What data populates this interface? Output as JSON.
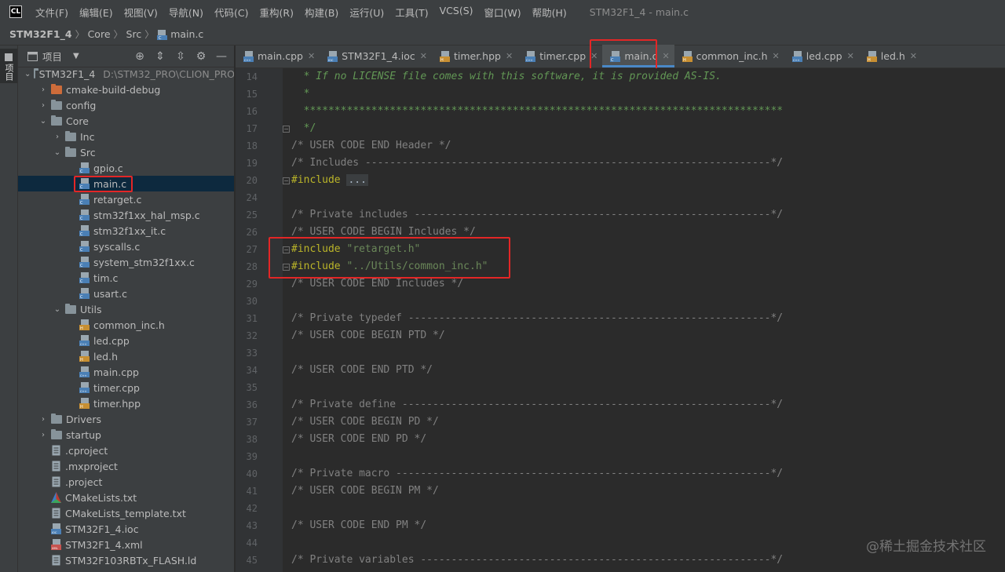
{
  "app": {
    "logo_text": "CL",
    "window_title": "STM32F1_4 - main.c"
  },
  "menu": [
    "文件(F)",
    "编辑(E)",
    "视图(V)",
    "导航(N)",
    "代码(C)",
    "重构(R)",
    "构建(B)",
    "运行(U)",
    "工具(T)",
    "VCS(S)",
    "窗口(W)",
    "帮助(H)"
  ],
  "breadcrumb": {
    "project": "STM32F1_4",
    "items": [
      "Core",
      "Src",
      "main.c"
    ]
  },
  "toolstrip": {
    "project_tab_label": "项目"
  },
  "project_panel": {
    "title": "项目",
    "tree": [
      {
        "label": "STM32F1_4",
        "hint": "D:\\STM32_PRO\\CLION_PRO",
        "kind": "folder",
        "depth": 0,
        "arrow": "down"
      },
      {
        "label": "cmake-build-debug",
        "kind": "folder-excluded",
        "depth": 1,
        "arrow": "right"
      },
      {
        "label": "config",
        "kind": "folder",
        "depth": 1,
        "arrow": "right"
      },
      {
        "label": "Core",
        "kind": "folder",
        "depth": 1,
        "arrow": "down"
      },
      {
        "label": "Inc",
        "kind": "folder",
        "depth": 2,
        "arrow": "right"
      },
      {
        "label": "Src",
        "kind": "folder",
        "depth": 2,
        "arrow": "down"
      },
      {
        "label": "gpio.c",
        "kind": "c",
        "depth": 3
      },
      {
        "label": "main.c",
        "kind": "c",
        "depth": 3,
        "selected": true
      },
      {
        "label": "retarget.c",
        "kind": "c",
        "depth": 3
      },
      {
        "label": "stm32f1xx_hal_msp.c",
        "kind": "c",
        "depth": 3
      },
      {
        "label": "stm32f1xx_it.c",
        "kind": "c",
        "depth": 3
      },
      {
        "label": "syscalls.c",
        "kind": "c",
        "depth": 3
      },
      {
        "label": "system_stm32f1xx.c",
        "kind": "c",
        "depth": 3
      },
      {
        "label": "tim.c",
        "kind": "c",
        "depth": 3
      },
      {
        "label": "usart.c",
        "kind": "c",
        "depth": 3
      },
      {
        "label": "Utils",
        "kind": "folder",
        "depth": 2,
        "arrow": "down"
      },
      {
        "label": "common_inc.h",
        "kind": "h",
        "depth": 3
      },
      {
        "label": "led.cpp",
        "kind": "cpp",
        "depth": 3
      },
      {
        "label": "led.h",
        "kind": "h",
        "depth": 3
      },
      {
        "label": "main.cpp",
        "kind": "cpp",
        "depth": 3
      },
      {
        "label": "timer.cpp",
        "kind": "cpp",
        "depth": 3
      },
      {
        "label": "timer.hpp",
        "kind": "h",
        "depth": 3
      },
      {
        "label": "Drivers",
        "kind": "folder",
        "depth": 1,
        "arrow": "right"
      },
      {
        "label": "startup",
        "kind": "folder",
        "depth": 1,
        "arrow": "right"
      },
      {
        "label": ".cproject",
        "kind": "text",
        "depth": 1
      },
      {
        "label": ".mxproject",
        "kind": "text",
        "depth": 1
      },
      {
        "label": ".project",
        "kind": "text",
        "depth": 1
      },
      {
        "label": "CMakeLists.txt",
        "kind": "cmake",
        "depth": 1
      },
      {
        "label": "CMakeLists_template.txt",
        "kind": "text",
        "depth": 1
      },
      {
        "label": "STM32F1_4.ioc",
        "kind": "ioc",
        "depth": 1
      },
      {
        "label": "STM32F1_4.xml",
        "kind": "xml",
        "depth": 1
      },
      {
        "label": "STM32F103RBTx_FLASH.ld",
        "kind": "text",
        "depth": 1
      }
    ]
  },
  "tabs": [
    {
      "label": "main.cpp",
      "kind": "cpp"
    },
    {
      "label": "STM32F1_4.ioc",
      "kind": "ioc"
    },
    {
      "label": "timer.hpp",
      "kind": "h"
    },
    {
      "label": "timer.cpp",
      "kind": "cpp"
    },
    {
      "label": "main.c",
      "kind": "c",
      "active": true
    },
    {
      "label": "common_inc.h",
      "kind": "h"
    },
    {
      "label": "led.cpp",
      "kind": "cpp"
    },
    {
      "label": "led.h",
      "kind": "h"
    }
  ],
  "editor": {
    "lines": [
      {
        "n": "14",
        "parts": [
          {
            "t": "  * If no LICENSE file comes with this software, it is provided AS-IS.",
            "c": "c-doc"
          }
        ]
      },
      {
        "n": "15",
        "parts": [
          {
            "t": "  *",
            "c": "c-doc"
          }
        ]
      },
      {
        "n": "16",
        "parts": [
          {
            "t": "  ******************************************************************************",
            "c": "c-doc-plain"
          }
        ]
      },
      {
        "n": "17",
        "fold": true,
        "parts": [
          {
            "t": "  */",
            "c": "c-doc-plain"
          }
        ]
      },
      {
        "n": "18",
        "parts": [
          {
            "t": "/* USER CODE END Header */",
            "c": "c-comment"
          }
        ]
      },
      {
        "n": "19",
        "parts": [
          {
            "t": "/* Includes ------------------------------------------------------------------*/",
            "c": "c-comment"
          }
        ]
      },
      {
        "n": "20",
        "fold": true,
        "parts": [
          {
            "t": "#include",
            "c": "c-kw"
          },
          {
            "t": " ",
            "c": ""
          },
          {
            "t": "...",
            "c": "c-fold"
          }
        ]
      },
      {
        "n": "24",
        "parts": []
      },
      {
        "n": "25",
        "parts": [
          {
            "t": "/* Private includes ----------------------------------------------------------*/",
            "c": "c-comment"
          }
        ]
      },
      {
        "n": "26",
        "parts": [
          {
            "t": "/* USER CODE BEGIN Includes */",
            "c": "c-comment"
          }
        ]
      },
      {
        "n": "27",
        "fold": true,
        "parts": [
          {
            "t": "#include",
            "c": "c-kw"
          },
          {
            "t": " ",
            "c": ""
          },
          {
            "t": "\"retarget.h\"",
            "c": "c-str"
          }
        ]
      },
      {
        "n": "28",
        "fold": true,
        "parts": [
          {
            "t": "#include",
            "c": "c-kw"
          },
          {
            "t": " ",
            "c": ""
          },
          {
            "t": "\"../Utils/common_inc.h\"",
            "c": "c-str"
          }
        ]
      },
      {
        "n": "29",
        "parts": [
          {
            "t": "/* USER CODE END Includes */",
            "c": "c-comment"
          }
        ]
      },
      {
        "n": "30",
        "parts": []
      },
      {
        "n": "31",
        "parts": [
          {
            "t": "/* Private typedef -----------------------------------------------------------*/",
            "c": "c-comment"
          }
        ]
      },
      {
        "n": "32",
        "parts": [
          {
            "t": "/* USER CODE BEGIN PTD */",
            "c": "c-comment"
          }
        ]
      },
      {
        "n": "33",
        "parts": []
      },
      {
        "n": "34",
        "parts": [
          {
            "t": "/* USER CODE END PTD */",
            "c": "c-comment"
          }
        ]
      },
      {
        "n": "35",
        "parts": []
      },
      {
        "n": "36",
        "parts": [
          {
            "t": "/* Private define ------------------------------------------------------------*/",
            "c": "c-comment"
          }
        ]
      },
      {
        "n": "37",
        "parts": [
          {
            "t": "/* USER CODE BEGIN PD */",
            "c": "c-comment"
          }
        ]
      },
      {
        "n": "38",
        "parts": [
          {
            "t": "/* USER CODE END PD */",
            "c": "c-comment"
          }
        ]
      },
      {
        "n": "39",
        "parts": []
      },
      {
        "n": "40",
        "parts": [
          {
            "t": "/* Private macro -------------------------------------------------------------*/",
            "c": "c-comment"
          }
        ]
      },
      {
        "n": "41",
        "parts": [
          {
            "t": "/* USER CODE BEGIN PM */",
            "c": "c-comment"
          }
        ]
      },
      {
        "n": "42",
        "parts": []
      },
      {
        "n": "43",
        "parts": [
          {
            "t": "/* USER CODE END PM */",
            "c": "c-comment"
          }
        ]
      },
      {
        "n": "44",
        "parts": []
      },
      {
        "n": "45",
        "parts": [
          {
            "t": "/* Private variables ---------------------------------------------------------*/",
            "c": "c-comment"
          }
        ]
      }
    ]
  },
  "watermark": "@稀土掘金技术社区",
  "colors": {
    "accent": "#4a88c7",
    "highlight_box": "#e32626",
    "selection": "#0d293e"
  }
}
